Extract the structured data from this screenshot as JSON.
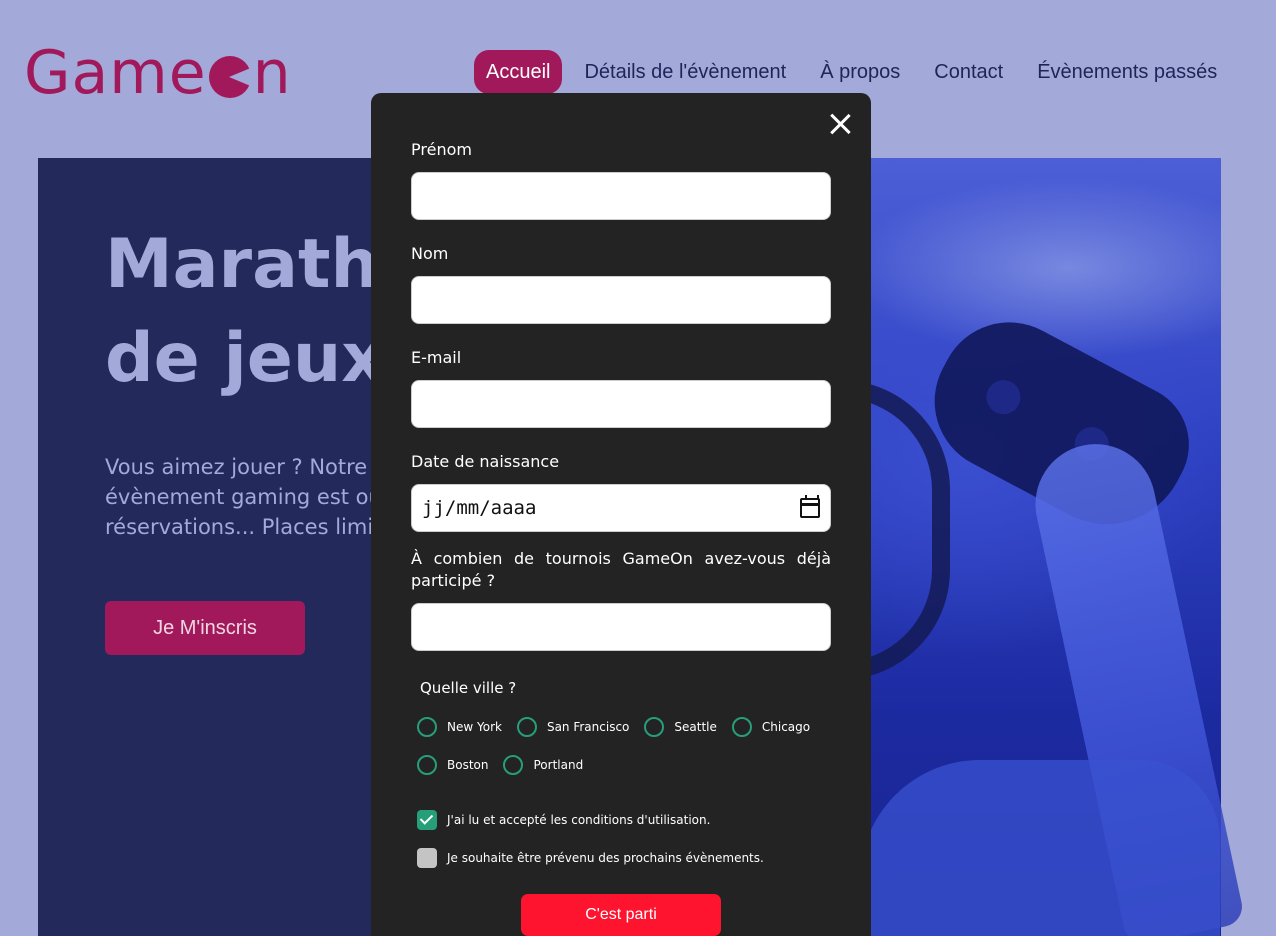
{
  "brand": {
    "logo_left": "Game",
    "logo_right": "n"
  },
  "nav": {
    "items": [
      {
        "label": "Accueil",
        "active": true
      },
      {
        "label": "Détails de l'évènement",
        "active": false
      },
      {
        "label": "À propos",
        "active": false
      },
      {
        "label": "Contact",
        "active": false
      },
      {
        "label": "Évènements passés",
        "active": false
      }
    ]
  },
  "hero": {
    "title_line1": "Marathon",
    "title_line2": "de jeux vidéo",
    "text_line1": "Vous aimez jouer ? Notre prochain",
    "text_line2": "évènement gaming est ouvert aux",
    "text_line3": "réservations... Places limitées !",
    "cta_label": "Je M'inscris"
  },
  "form": {
    "first_name_label": "Prénom",
    "first_name_value": "",
    "last_name_label": "Nom",
    "last_name_value": "",
    "email_label": "E-mail",
    "email_value": "",
    "birthdate_label": "Date de naissance",
    "birthdate_placeholder": "jj/mm/aaaa",
    "tournaments_label": "À combien de tournois GameOn avez-vous déjà participé ?",
    "tournaments_value": "",
    "city_label": "Quelle ville ?",
    "cities": [
      "New York",
      "San Francisco",
      "Seattle",
      "Chicago",
      "Boston",
      "Portland"
    ],
    "terms_label": "J'ai lu et accepté les conditions d'utilisation.",
    "terms_checked": true,
    "newsletter_label": "Je souhaite être prévenu des prochains évènements.",
    "newsletter_checked": false,
    "submit_label": "C'est parti"
  },
  "colors": {
    "page_bg": "#a3a9d8",
    "brand": "#a1195a",
    "hero_bg": "#232a5b",
    "modal_bg": "#232323",
    "radio_accent": "#279e7a",
    "submit_bg": "#fe142f"
  }
}
